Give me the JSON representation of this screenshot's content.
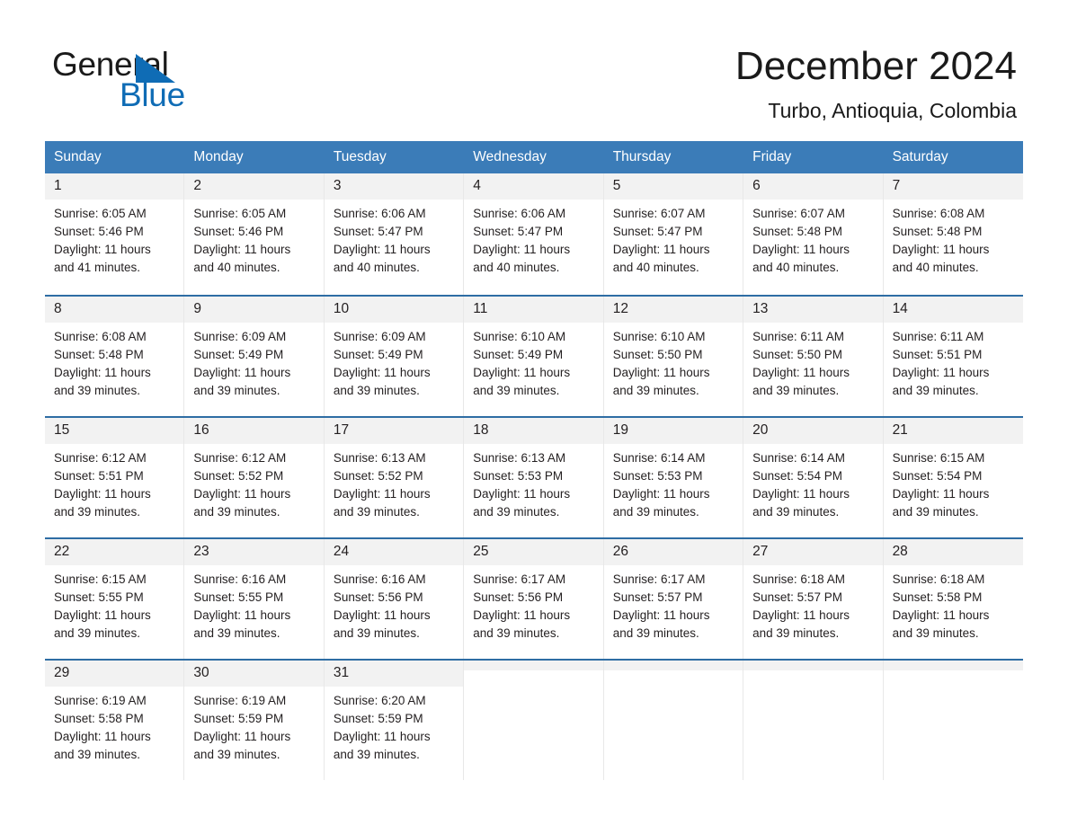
{
  "brand": {
    "name_part1": "General",
    "name_part2": "Blue"
  },
  "header": {
    "month_title": "December 2024",
    "location": "Turbo, Antioquia, Colombia"
  },
  "colors": {
    "header_blue": "#3b7cb8",
    "row_rule_blue": "#2e6da4",
    "brand_blue": "#0f6cb5",
    "day_number_band": "#f2f2f2"
  },
  "weekday_headers": [
    "Sunday",
    "Monday",
    "Tuesday",
    "Wednesday",
    "Thursday",
    "Friday",
    "Saturday"
  ],
  "weeks": [
    [
      {
        "day": "1",
        "sunrise": "Sunrise: 6:05 AM",
        "sunset": "Sunset: 5:46 PM",
        "daylight_line1": "Daylight: 11 hours",
        "daylight_line2": "and 41 minutes."
      },
      {
        "day": "2",
        "sunrise": "Sunrise: 6:05 AM",
        "sunset": "Sunset: 5:46 PM",
        "daylight_line1": "Daylight: 11 hours",
        "daylight_line2": "and 40 minutes."
      },
      {
        "day": "3",
        "sunrise": "Sunrise: 6:06 AM",
        "sunset": "Sunset: 5:47 PM",
        "daylight_line1": "Daylight: 11 hours",
        "daylight_line2": "and 40 minutes."
      },
      {
        "day": "4",
        "sunrise": "Sunrise: 6:06 AM",
        "sunset": "Sunset: 5:47 PM",
        "daylight_line1": "Daylight: 11 hours",
        "daylight_line2": "and 40 minutes."
      },
      {
        "day": "5",
        "sunrise": "Sunrise: 6:07 AM",
        "sunset": "Sunset: 5:47 PM",
        "daylight_line1": "Daylight: 11 hours",
        "daylight_line2": "and 40 minutes."
      },
      {
        "day": "6",
        "sunrise": "Sunrise: 6:07 AM",
        "sunset": "Sunset: 5:48 PM",
        "daylight_line1": "Daylight: 11 hours",
        "daylight_line2": "and 40 minutes."
      },
      {
        "day": "7",
        "sunrise": "Sunrise: 6:08 AM",
        "sunset": "Sunset: 5:48 PM",
        "daylight_line1": "Daylight: 11 hours",
        "daylight_line2": "and 40 minutes."
      }
    ],
    [
      {
        "day": "8",
        "sunrise": "Sunrise: 6:08 AM",
        "sunset": "Sunset: 5:48 PM",
        "daylight_line1": "Daylight: 11 hours",
        "daylight_line2": "and 39 minutes."
      },
      {
        "day": "9",
        "sunrise": "Sunrise: 6:09 AM",
        "sunset": "Sunset: 5:49 PM",
        "daylight_line1": "Daylight: 11 hours",
        "daylight_line2": "and 39 minutes."
      },
      {
        "day": "10",
        "sunrise": "Sunrise: 6:09 AM",
        "sunset": "Sunset: 5:49 PM",
        "daylight_line1": "Daylight: 11 hours",
        "daylight_line2": "and 39 minutes."
      },
      {
        "day": "11",
        "sunrise": "Sunrise: 6:10 AM",
        "sunset": "Sunset: 5:49 PM",
        "daylight_line1": "Daylight: 11 hours",
        "daylight_line2": "and 39 minutes."
      },
      {
        "day": "12",
        "sunrise": "Sunrise: 6:10 AM",
        "sunset": "Sunset: 5:50 PM",
        "daylight_line1": "Daylight: 11 hours",
        "daylight_line2": "and 39 minutes."
      },
      {
        "day": "13",
        "sunrise": "Sunrise: 6:11 AM",
        "sunset": "Sunset: 5:50 PM",
        "daylight_line1": "Daylight: 11 hours",
        "daylight_line2": "and 39 minutes."
      },
      {
        "day": "14",
        "sunrise": "Sunrise: 6:11 AM",
        "sunset": "Sunset: 5:51 PM",
        "daylight_line1": "Daylight: 11 hours",
        "daylight_line2": "and 39 minutes."
      }
    ],
    [
      {
        "day": "15",
        "sunrise": "Sunrise: 6:12 AM",
        "sunset": "Sunset: 5:51 PM",
        "daylight_line1": "Daylight: 11 hours",
        "daylight_line2": "and 39 minutes."
      },
      {
        "day": "16",
        "sunrise": "Sunrise: 6:12 AM",
        "sunset": "Sunset: 5:52 PM",
        "daylight_line1": "Daylight: 11 hours",
        "daylight_line2": "and 39 minutes."
      },
      {
        "day": "17",
        "sunrise": "Sunrise: 6:13 AM",
        "sunset": "Sunset: 5:52 PM",
        "daylight_line1": "Daylight: 11 hours",
        "daylight_line2": "and 39 minutes."
      },
      {
        "day": "18",
        "sunrise": "Sunrise: 6:13 AM",
        "sunset": "Sunset: 5:53 PM",
        "daylight_line1": "Daylight: 11 hours",
        "daylight_line2": "and 39 minutes."
      },
      {
        "day": "19",
        "sunrise": "Sunrise: 6:14 AM",
        "sunset": "Sunset: 5:53 PM",
        "daylight_line1": "Daylight: 11 hours",
        "daylight_line2": "and 39 minutes."
      },
      {
        "day": "20",
        "sunrise": "Sunrise: 6:14 AM",
        "sunset": "Sunset: 5:54 PM",
        "daylight_line1": "Daylight: 11 hours",
        "daylight_line2": "and 39 minutes."
      },
      {
        "day": "21",
        "sunrise": "Sunrise: 6:15 AM",
        "sunset": "Sunset: 5:54 PM",
        "daylight_line1": "Daylight: 11 hours",
        "daylight_line2": "and 39 minutes."
      }
    ],
    [
      {
        "day": "22",
        "sunrise": "Sunrise: 6:15 AM",
        "sunset": "Sunset: 5:55 PM",
        "daylight_line1": "Daylight: 11 hours",
        "daylight_line2": "and 39 minutes."
      },
      {
        "day": "23",
        "sunrise": "Sunrise: 6:16 AM",
        "sunset": "Sunset: 5:55 PM",
        "daylight_line1": "Daylight: 11 hours",
        "daylight_line2": "and 39 minutes."
      },
      {
        "day": "24",
        "sunrise": "Sunrise: 6:16 AM",
        "sunset": "Sunset: 5:56 PM",
        "daylight_line1": "Daylight: 11 hours",
        "daylight_line2": "and 39 minutes."
      },
      {
        "day": "25",
        "sunrise": "Sunrise: 6:17 AM",
        "sunset": "Sunset: 5:56 PM",
        "daylight_line1": "Daylight: 11 hours",
        "daylight_line2": "and 39 minutes."
      },
      {
        "day": "26",
        "sunrise": "Sunrise: 6:17 AM",
        "sunset": "Sunset: 5:57 PM",
        "daylight_line1": "Daylight: 11 hours",
        "daylight_line2": "and 39 minutes."
      },
      {
        "day": "27",
        "sunrise": "Sunrise: 6:18 AM",
        "sunset": "Sunset: 5:57 PM",
        "daylight_line1": "Daylight: 11 hours",
        "daylight_line2": "and 39 minutes."
      },
      {
        "day": "28",
        "sunrise": "Sunrise: 6:18 AM",
        "sunset": "Sunset: 5:58 PM",
        "daylight_line1": "Daylight: 11 hours",
        "daylight_line2": "and 39 minutes."
      }
    ],
    [
      {
        "day": "29",
        "sunrise": "Sunrise: 6:19 AM",
        "sunset": "Sunset: 5:58 PM",
        "daylight_line1": "Daylight: 11 hours",
        "daylight_line2": "and 39 minutes."
      },
      {
        "day": "30",
        "sunrise": "Sunrise: 6:19 AM",
        "sunset": "Sunset: 5:59 PM",
        "daylight_line1": "Daylight: 11 hours",
        "daylight_line2": "and 39 minutes."
      },
      {
        "day": "31",
        "sunrise": "Sunrise: 6:20 AM",
        "sunset": "Sunset: 5:59 PM",
        "daylight_line1": "Daylight: 11 hours",
        "daylight_line2": "and 39 minutes."
      },
      {
        "day": "",
        "sunrise": "",
        "sunset": "",
        "daylight_line1": "",
        "daylight_line2": ""
      },
      {
        "day": "",
        "sunrise": "",
        "sunset": "",
        "daylight_line1": "",
        "daylight_line2": ""
      },
      {
        "day": "",
        "sunrise": "",
        "sunset": "",
        "daylight_line1": "",
        "daylight_line2": ""
      },
      {
        "day": "",
        "sunrise": "",
        "sunset": "",
        "daylight_line1": "",
        "daylight_line2": ""
      }
    ]
  ]
}
